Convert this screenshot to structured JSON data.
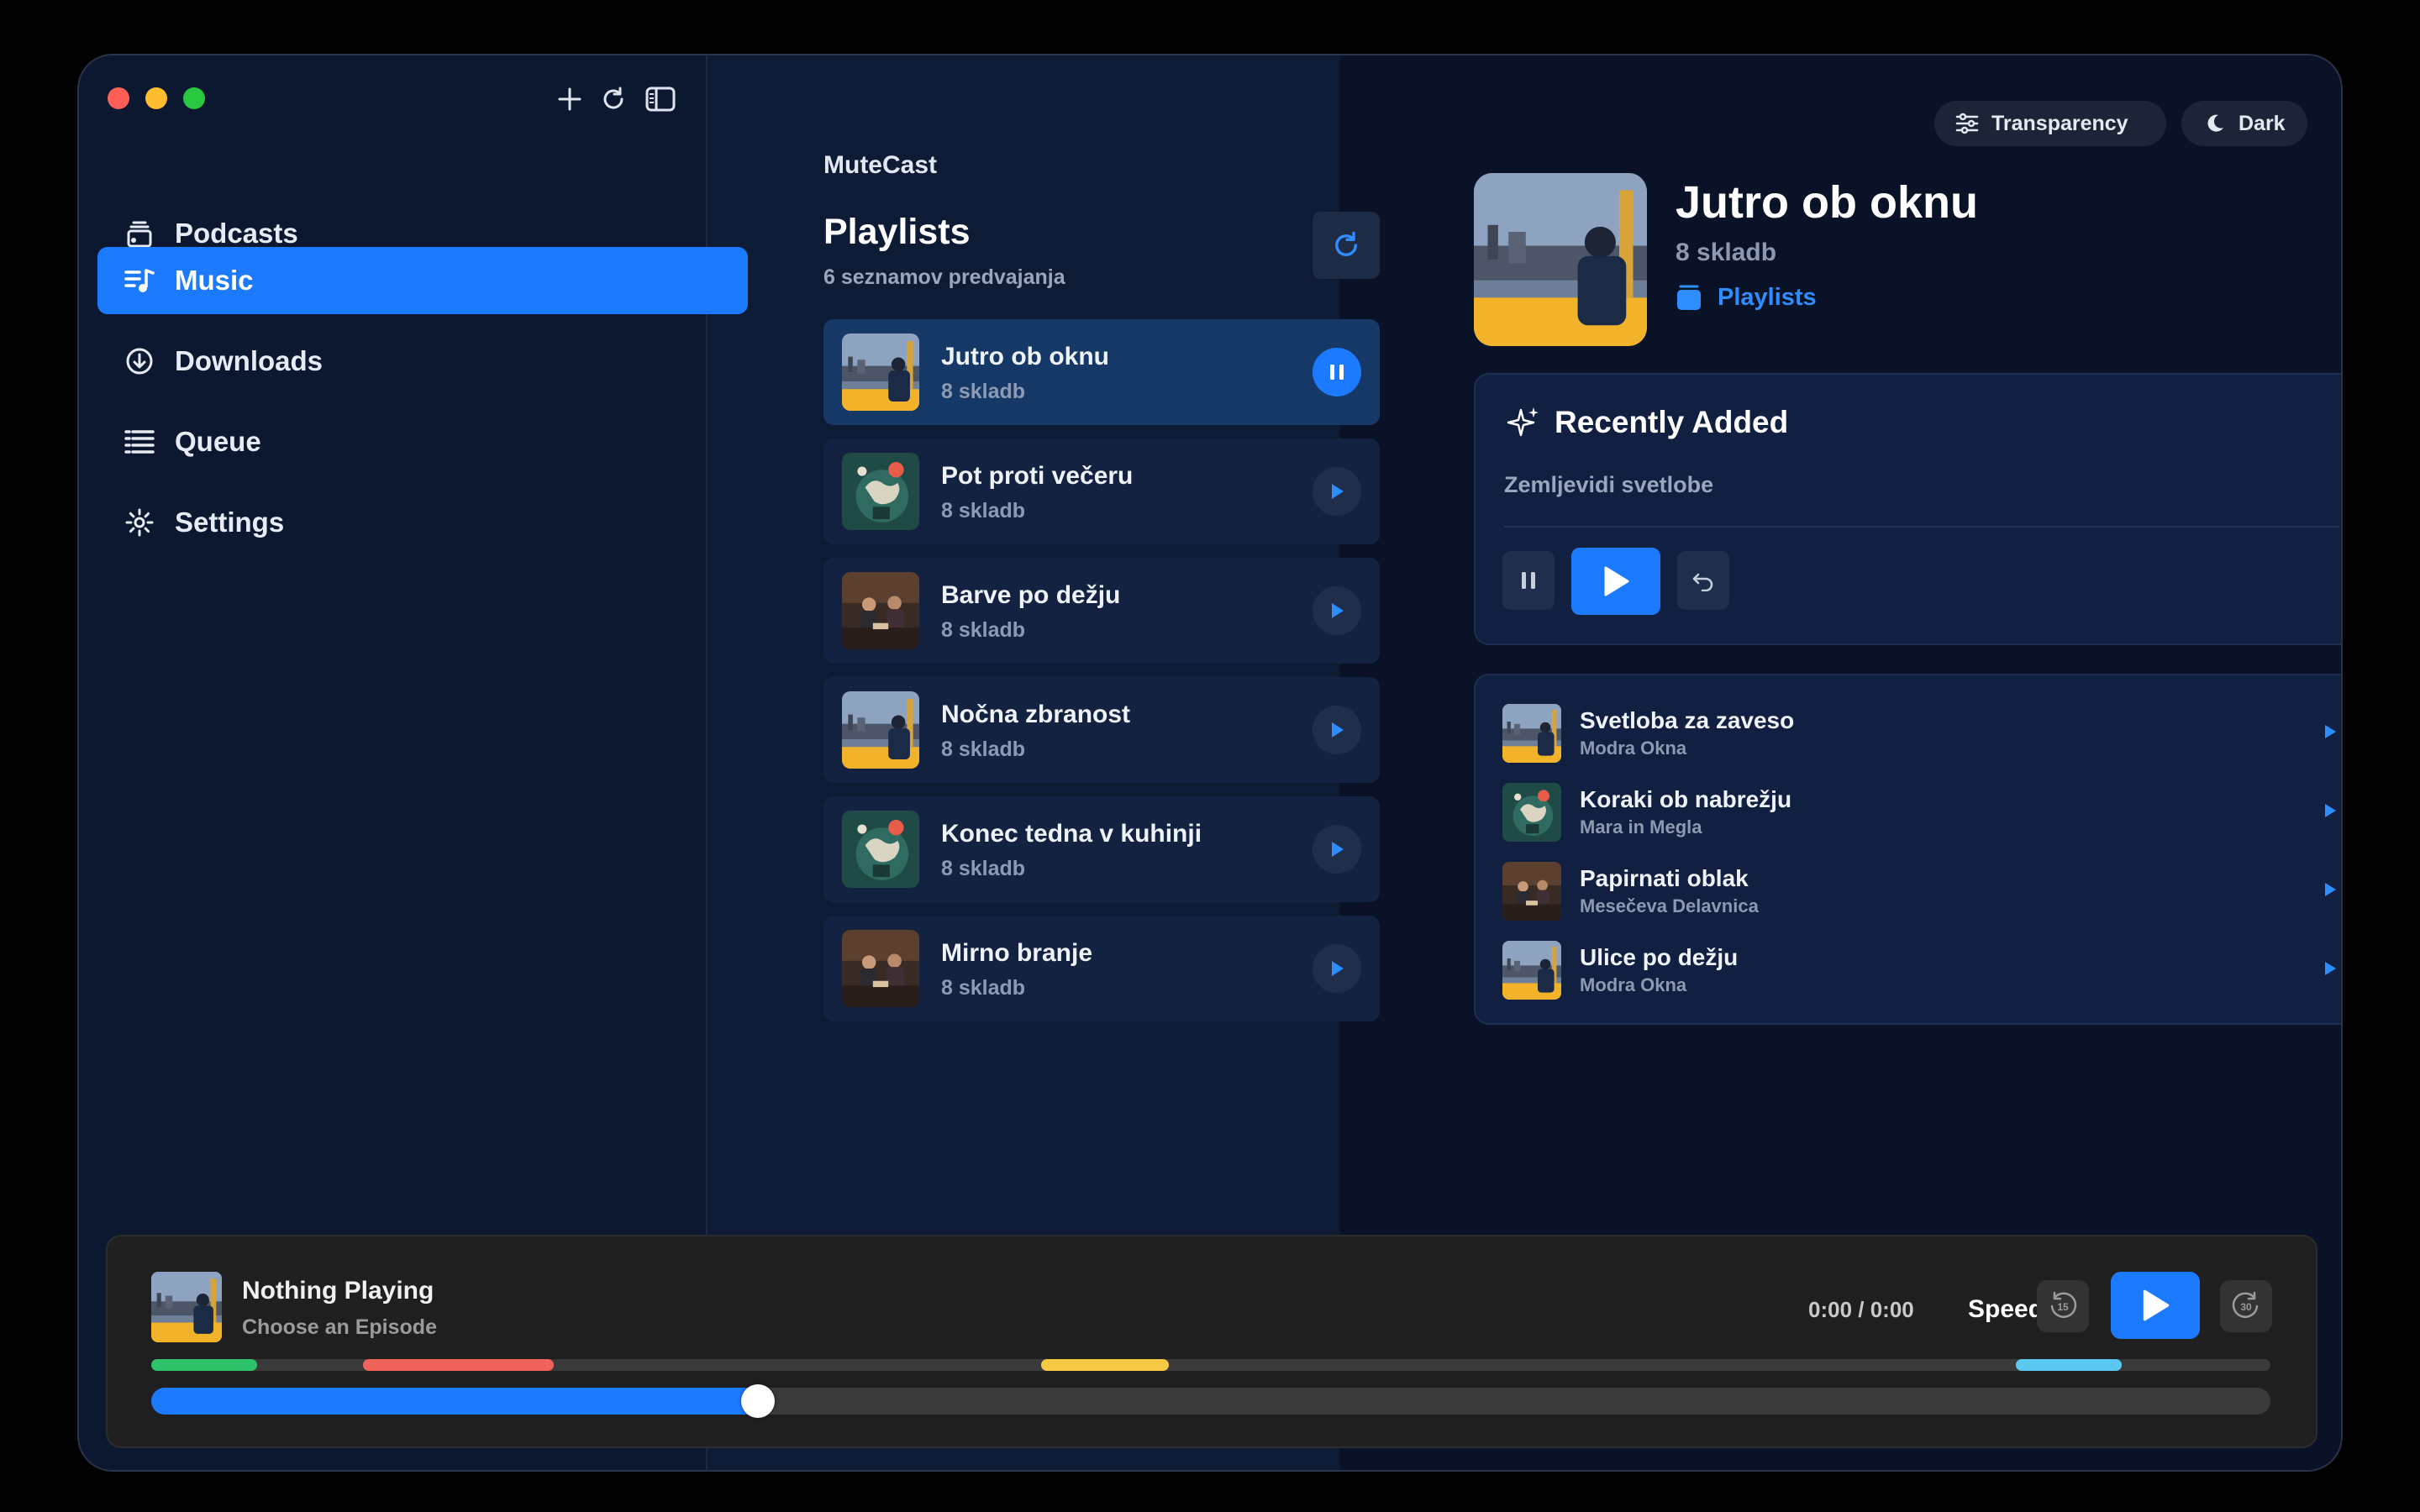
{
  "colors": {
    "accent": "#1c7aff",
    "window_bg": "#0a1227",
    "sidebar_bg": "#0c1730"
  },
  "window": {
    "controls": [
      "close",
      "minimize",
      "zoom"
    ],
    "toolbar_icons": [
      "plus-icon",
      "refresh-icon",
      "sidebar-toggle-icon"
    ]
  },
  "sidebar": {
    "items": [
      {
        "label": "Podcasts",
        "icon": "podcast-stack-icon",
        "active": false
      },
      {
        "label": "Music",
        "icon": "music-note-list-icon",
        "active": true
      },
      {
        "label": "Downloads",
        "icon": "download-circle-icon",
        "active": false
      },
      {
        "label": "Queue",
        "icon": "queue-list-icon",
        "active": false
      },
      {
        "label": "Settings",
        "icon": "gear-icon",
        "active": false
      }
    ]
  },
  "middle": {
    "app_name": "MuteCast",
    "heading": "Playlists",
    "subheading": "6 seznamov predvajanja",
    "playlists": [
      {
        "name": "Jutro ob oknu",
        "count": "8 skladb",
        "active": true,
        "art": "city"
      },
      {
        "name": "Pot proti večeru",
        "count": "8 skladb",
        "active": false,
        "art": "map"
      },
      {
        "name": "Barve po dežju",
        "count": "8 skladb",
        "active": false,
        "art": "room"
      },
      {
        "name": "Nočna zbranost",
        "count": "8 skladb",
        "active": false,
        "art": "city"
      },
      {
        "name": "Konec tedna v kuhinji",
        "count": "8 skladb",
        "active": false,
        "art": "map"
      },
      {
        "name": "Mirno branje",
        "count": "8 skladb",
        "active": false,
        "art": "room"
      }
    ]
  },
  "detail": {
    "transparency_label": "Transparency",
    "theme_label": "Dark",
    "title": "Jutro ob oknu",
    "subtitle": "8 skladb",
    "link_label": "Playlists",
    "recently_added": {
      "title": "Recently Added",
      "subtitle": "Zemljevidi svetlobe"
    },
    "tracks": [
      {
        "title": "Svetloba za zaveso",
        "artist": "Modra Okna",
        "art": "city"
      },
      {
        "title": "Koraki ob nabrežju",
        "artist": "Mara in Megla",
        "art": "map"
      },
      {
        "title": "Papirnati oblak",
        "artist": "Mesečeva Delavnica",
        "art": "room"
      },
      {
        "title": "Ulice po dežju",
        "artist": "Modra Okna",
        "art": "city"
      }
    ]
  },
  "player": {
    "title": "Nothing Playing",
    "subtitle": "Choose an Episode",
    "time": "0:00 / 0:00",
    "speed_label": "Speed",
    "skip_back_label": "15",
    "skip_forward_label": "30",
    "progress": 0.28,
    "chapters": [
      {
        "start": 0.0,
        "end": 0.05,
        "color": "#2ec26a"
      },
      {
        "start": 0.1,
        "end": 0.19,
        "color": "#f0625a"
      },
      {
        "start": 0.42,
        "end": 0.48,
        "color": "#f6c945"
      },
      {
        "start": 0.88,
        "end": 0.93,
        "color": "#5ac8f0"
      }
    ]
  }
}
